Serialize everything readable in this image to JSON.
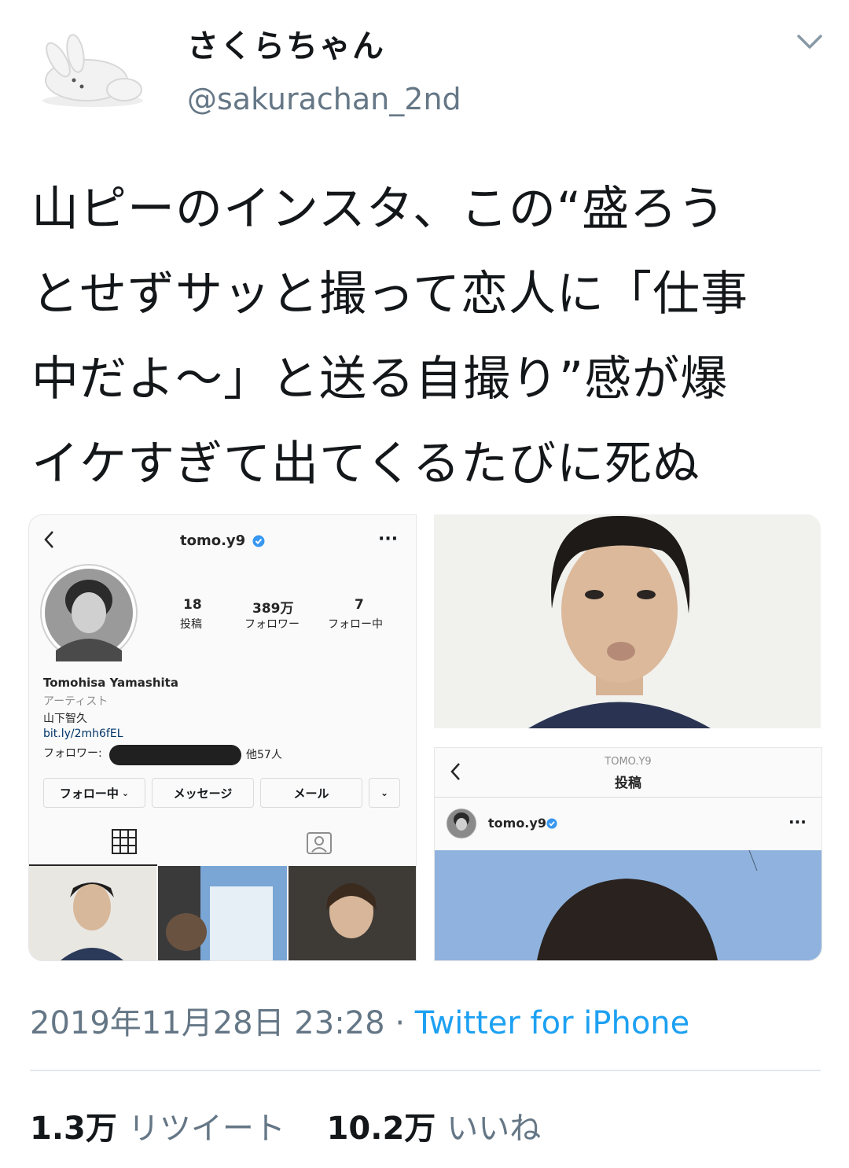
{
  "user": {
    "display_name": "さくらちゃん",
    "handle": "@sakurachan_2nd"
  },
  "tweet": {
    "lines": [
      "山ピーのインスタ、この“盛ろう",
      "とせずサッと撮って恋人に「仕事",
      "中だよ〜」と送る自撮り”感が爆",
      "イケすぎて出てくるたびに死ぬ"
    ]
  },
  "media": {
    "profile": {
      "username": "tomo.y9",
      "posts_count": "18",
      "posts_label": "投稿",
      "followers_count": "389万",
      "followers_label": "フォロワー",
      "following_count": "7",
      "following_label": "フォロー中",
      "name": "Tomohisa Yamashita",
      "category": "アーティスト",
      "bio_name": "山下智久",
      "link": "bit.ly/2mh6fEL",
      "followed_by_label": "フォロワー:",
      "followed_by_others": "他57人",
      "btn_following": "フォロー中",
      "btn_message": "メッセージ",
      "btn_mail": "メール"
    },
    "post": {
      "header_user": "TOMO.Y9",
      "header_title": "投稿",
      "username": "tomo.y9"
    }
  },
  "footer": {
    "timestamp": "2019年11月28日 23:28",
    "separator": "·",
    "source": "Twitter for iPhone",
    "retweets_count": "1.3万",
    "retweets_label": "リツイート",
    "likes_count": "10.2万",
    "likes_label": "いいね"
  },
  "colors": {
    "link_blue": "#1da1f2",
    "secondary_text": "#657786",
    "verified_blue": "#3897f0"
  },
  "icons": [
    "chevron-down-icon",
    "back-arrow-icon",
    "verified-badge-icon",
    "more-dots-icon",
    "grid-icon",
    "tagged-icon"
  ]
}
